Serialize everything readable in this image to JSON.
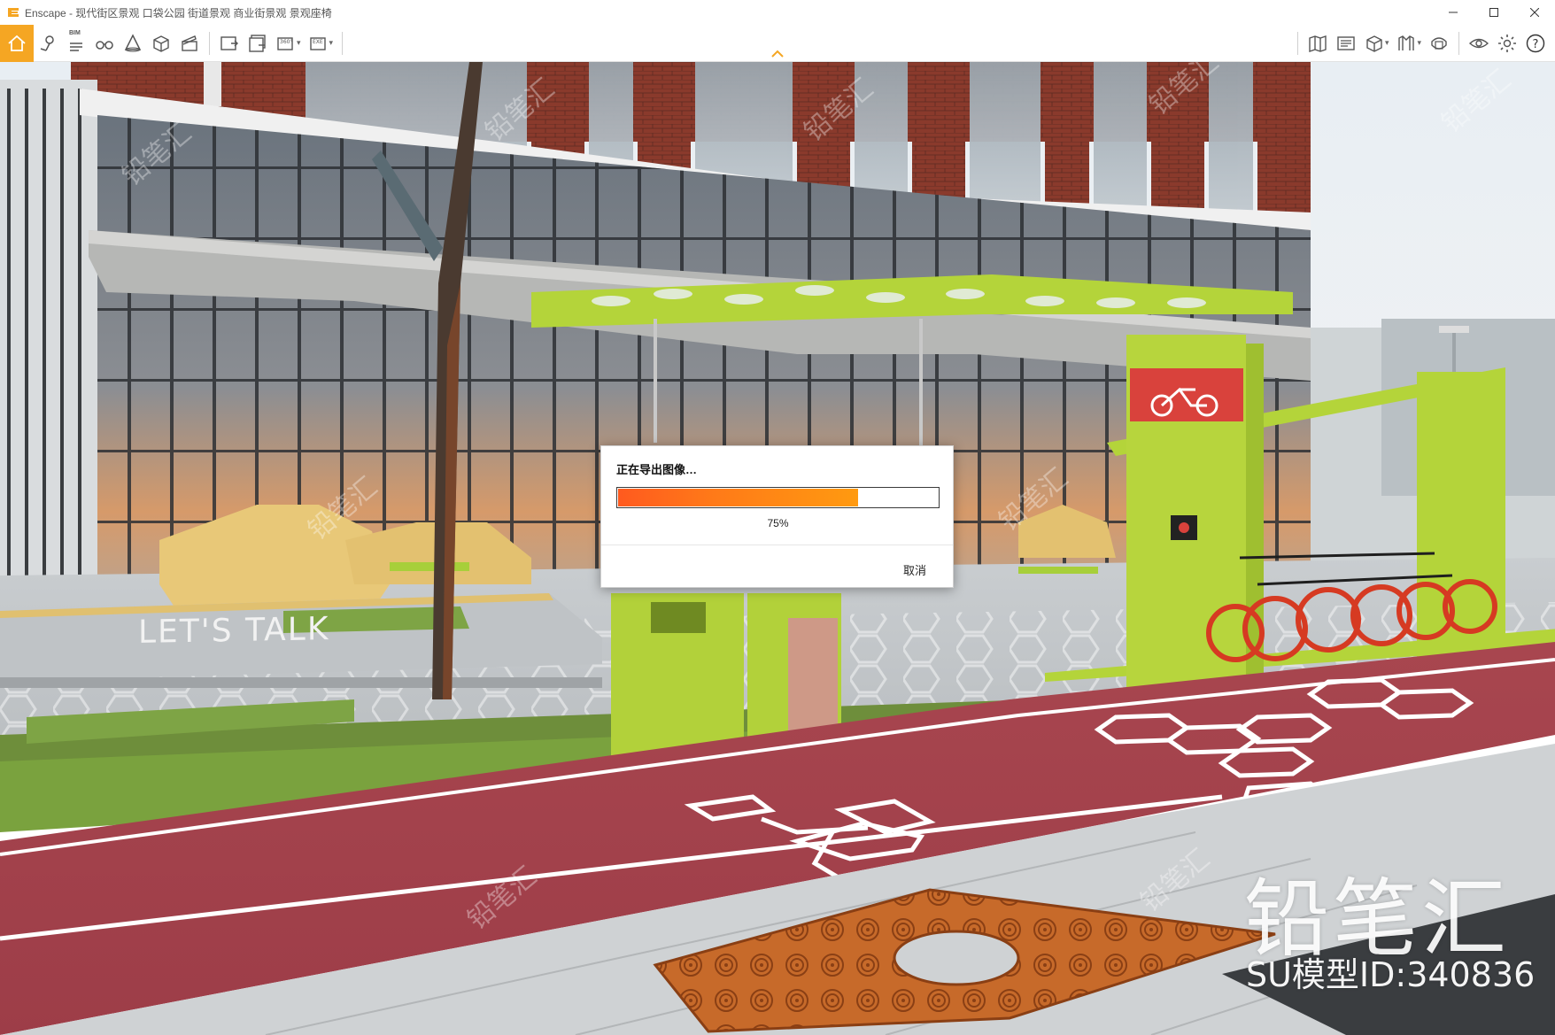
{
  "window": {
    "app_name": "Enscape",
    "title_tags": "现代街区景观 口袋公园 街道景观 商业街景观 景观座椅"
  },
  "toolbar": {
    "bim_label": "BIM",
    "panorama_label": "360°",
    "export_label": "EXE",
    "icons": [
      "home-icon",
      "location-pin-icon",
      "bim-icon",
      "binoculars-icon",
      "cone-icon",
      "box-icon",
      "clapper-icon",
      "screenshot-icon",
      "batch-render-icon",
      "panorama-icon",
      "exe-export-icon",
      "map-icon",
      "asset-library-icon",
      "cube-icon",
      "material-icon",
      "visual-settings-icon",
      "eye-icon",
      "gear-icon",
      "help-icon"
    ]
  },
  "dialog": {
    "title": "正在导出图像…",
    "progress_value": 0.75,
    "progress_text": "75%",
    "cancel_label": "取消"
  },
  "scene": {
    "sign_text": "LET'S  TALK",
    "watermark_brand": "铅笔汇",
    "watermark_id": "SU模型ID:340836",
    "watermark_small": "铅笔汇"
  },
  "colors": {
    "accent": "#f5a623",
    "bike_lane": "#a94452",
    "shelter_green": "#b4d43a",
    "progress_start": "#ff5a1f",
    "progress_end": "#ff9a10"
  }
}
